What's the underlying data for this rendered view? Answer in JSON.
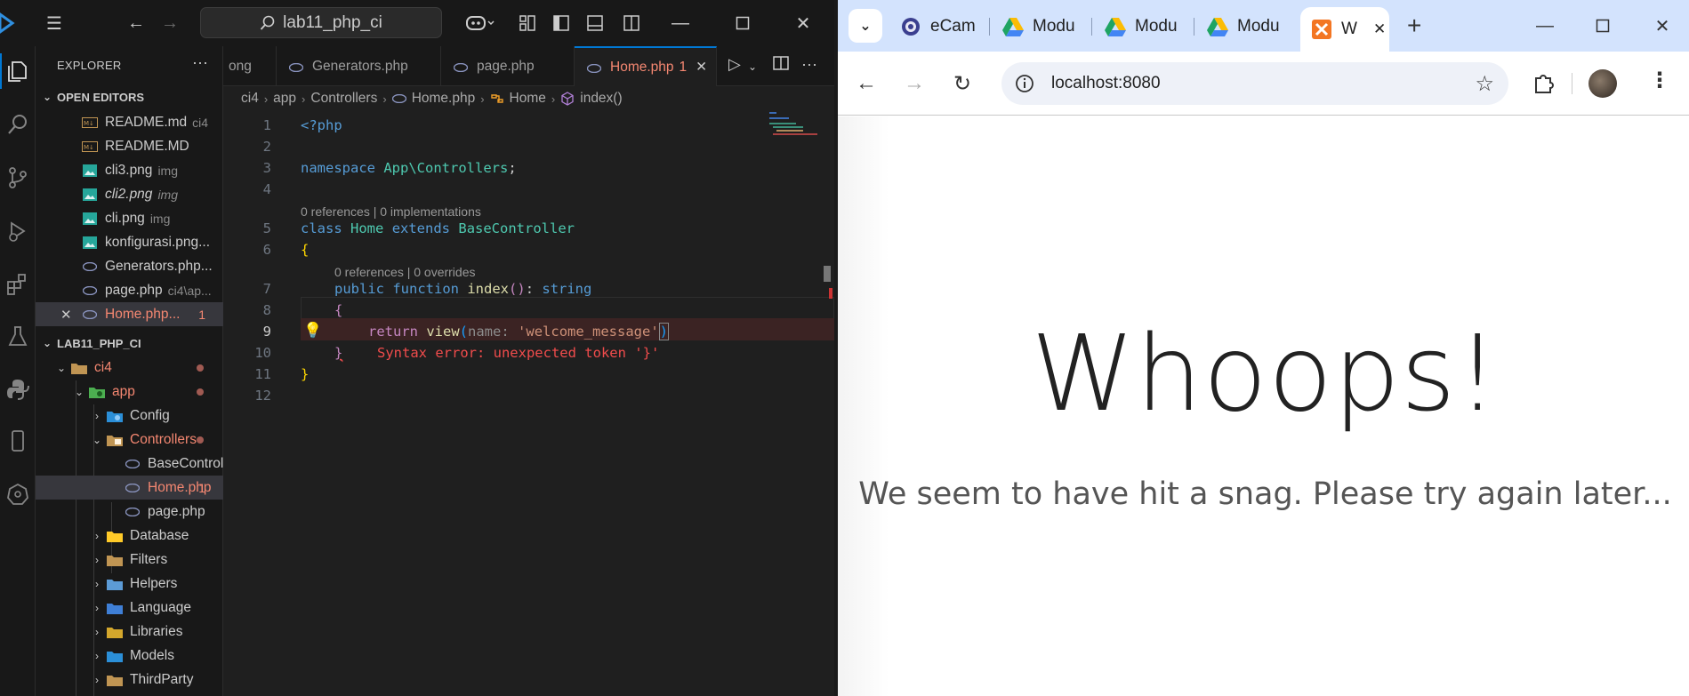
{
  "vscode": {
    "search_text": "lab11_php_ci",
    "explorer_title": "EXPLORER",
    "open_editors_label": "OPEN EDITORS",
    "open_editors": [
      {
        "name": "README.md",
        "hint": "ci4"
      },
      {
        "name": "README.MD",
        "hint": ""
      },
      {
        "name": "cli3.png",
        "hint": "img"
      },
      {
        "name": "cli2.png",
        "hint": "img"
      },
      {
        "name": "cli.png",
        "hint": "img"
      },
      {
        "name": "konfigurasi.png...",
        "hint": ""
      },
      {
        "name": "Generators.php...",
        "hint": ""
      },
      {
        "name": "page.php",
        "hint": "ci4\\ap..."
      },
      {
        "name": "Home.php...",
        "hint": "",
        "badge": "1"
      }
    ],
    "project_label": "LAB11_PHP_CI",
    "tree": {
      "ci4": "ci4",
      "app": "app",
      "config": "Config",
      "controllers": "Controllers",
      "base_controller": "BaseControlle...",
      "home": "Home.php",
      "home_badge": "1",
      "page": "page.php",
      "database": "Database",
      "filters": "Filters",
      "helpers": "Helpers",
      "language": "Language",
      "libraries": "Libraries",
      "models": "Models",
      "thirdparty": "ThirdParty"
    },
    "tabs": [
      {
        "label": "ong"
      },
      {
        "label": "Generators.php"
      },
      {
        "label": "page.php"
      },
      {
        "label": "Home.php",
        "badge": "1"
      }
    ],
    "breadcrumb": [
      "ci4",
      "app",
      "Controllers",
      "Home.php",
      "Home",
      "index()"
    ],
    "code": {
      "l1": "<?php",
      "ns_kw": "namespace",
      "ns_name": "App\\Controllers",
      "lens1": "0 references | 0 implementations",
      "class_kw": "class",
      "class_name": "Home",
      "extends_kw": "extends",
      "base_name": "BaseController",
      "lens2": "0 references | 0 overrides",
      "public_kw": "public",
      "function_kw": "function",
      "fn_name": "index",
      "return_type": "string",
      "return_kw": "return",
      "view_fn": "view",
      "param_hint": "name:",
      "arg": "'welcome_message'",
      "error_msg": "Syntax error: unexpected token '}'"
    },
    "line_numbers": [
      "1",
      "2",
      "3",
      "4",
      "5",
      "6",
      "7",
      "8",
      "9",
      "10",
      "11",
      "12"
    ]
  },
  "chrome": {
    "tabs": [
      {
        "label": "eCam"
      },
      {
        "label": "Modu"
      },
      {
        "label": "Modu"
      },
      {
        "label": "Modu"
      },
      {
        "label": "W"
      }
    ],
    "url": "localhost:8080",
    "page_heading": "Whoops!",
    "page_message": "We seem to have hit a snag. Please try again later..."
  }
}
